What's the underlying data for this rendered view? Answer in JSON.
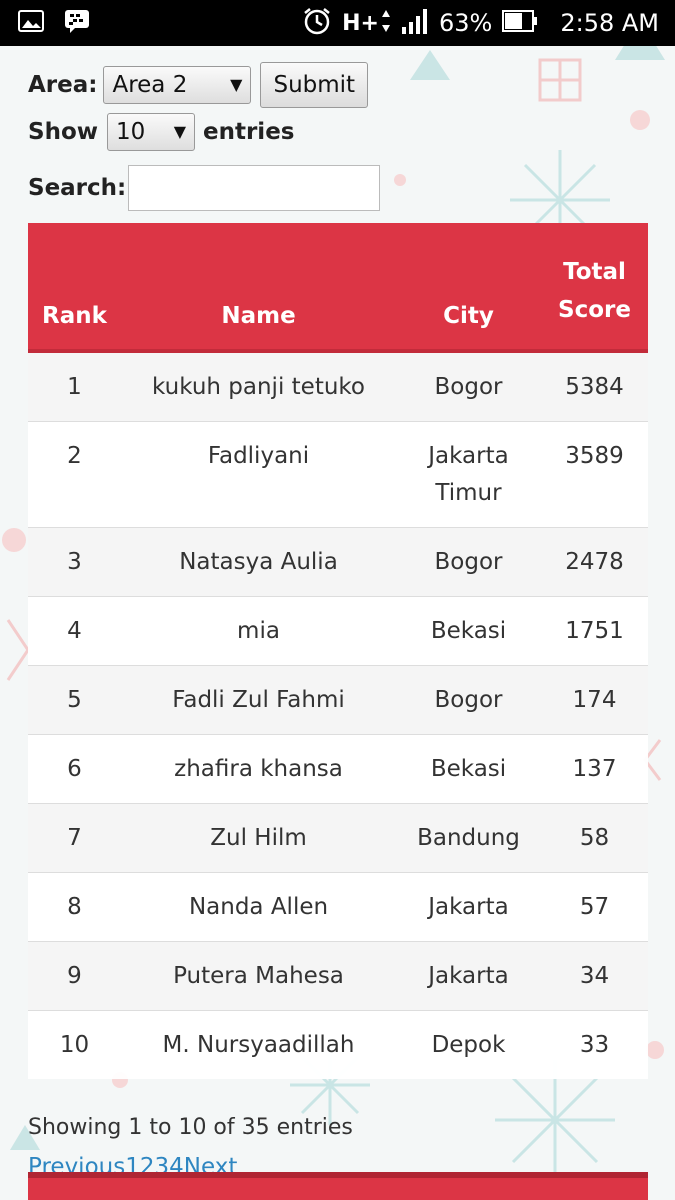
{
  "status_bar": {
    "battery_percent": "63%",
    "time": "2:58 AM",
    "network": "H+"
  },
  "area": {
    "label": "Area:",
    "selected": "Area 2",
    "submit_label": "Submit"
  },
  "length": {
    "show_label": "Show",
    "selected": "10",
    "entries_label": "entries"
  },
  "search": {
    "label": "Search:",
    "value": ""
  },
  "table": {
    "headers": {
      "rank": "Rank",
      "name": "Name",
      "city": "City",
      "score_line1": "Total",
      "score_line2": "Score"
    },
    "rows": [
      {
        "rank": "1",
        "name": "kukuh panji tetuko",
        "city": "Bogor",
        "score": "5384"
      },
      {
        "rank": "2",
        "name": "Fadliyani",
        "city": "Jakarta Timur",
        "score": "3589"
      },
      {
        "rank": "3",
        "name": "Natasya Aulia",
        "city": "Bogor",
        "score": "2478"
      },
      {
        "rank": "4",
        "name": "mia",
        "city": "Bekasi",
        "score": "1751"
      },
      {
        "rank": "5",
        "name": "Fadli Zul Fahmi",
        "city": "Bogor",
        "score": "174"
      },
      {
        "rank": "6",
        "name": "zhafira khansa",
        "city": "Bekasi",
        "score": "137"
      },
      {
        "rank": "7",
        "name": "Zul Hilm",
        "city": "Bandung",
        "score": "58"
      },
      {
        "rank": "8",
        "name": "Nanda Allen",
        "city": "Jakarta",
        "score": "57"
      },
      {
        "rank": "9",
        "name": "Putera Mahesa",
        "city": "Jakarta",
        "score": "34"
      },
      {
        "rank": "10",
        "name": "M. Nursyaadillah",
        "city": "Depok",
        "score": "33"
      }
    ]
  },
  "info_text": "Showing 1 to 10 of 35 entries",
  "pagination": {
    "previous": "Previous",
    "pages": [
      "1",
      "2",
      "3",
      "4"
    ],
    "next": "Next"
  },
  "colors": {
    "header_red": "#dc3545",
    "link_blue": "#2e86c1"
  }
}
